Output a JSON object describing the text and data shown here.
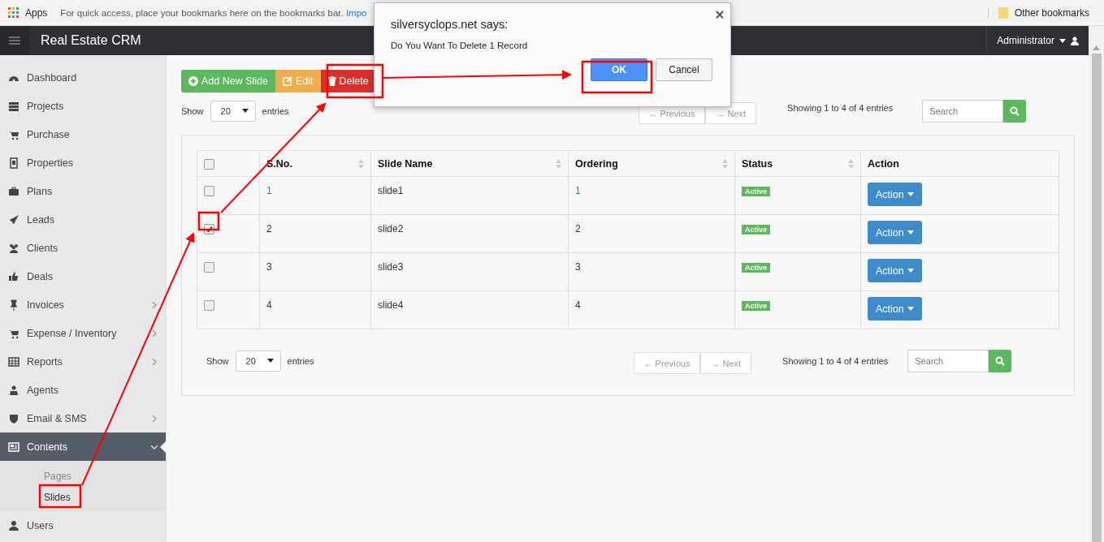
{
  "bookmarks_bar": {
    "apps": "Apps",
    "hint": "For quick access, place your bookmarks here on the bookmarks bar.",
    "import_link": "Impo",
    "other": "Other bookmarks"
  },
  "header": {
    "title": "Real Estate CRM",
    "user": "Administrator"
  },
  "sidebar": {
    "items": [
      {
        "label": "Dashboard",
        "expandable": false,
        "expanded": false,
        "selected": false
      },
      {
        "label": "Projects",
        "expandable": false,
        "expanded": false,
        "selected": false
      },
      {
        "label": "Purchase",
        "expandable": false,
        "expanded": false,
        "selected": false
      },
      {
        "label": "Properties",
        "expandable": false,
        "expanded": false,
        "selected": false
      },
      {
        "label": "Plans",
        "expandable": false,
        "expanded": false,
        "selected": false
      },
      {
        "label": "Leads",
        "expandable": false,
        "expanded": false,
        "selected": false
      },
      {
        "label": "Clients",
        "expandable": false,
        "expanded": false,
        "selected": false
      },
      {
        "label": "Deals",
        "expandable": false,
        "expanded": false,
        "selected": false
      },
      {
        "label": "Invoices",
        "expandable": true,
        "expanded": false,
        "selected": false
      },
      {
        "label": "Expense / Inventory",
        "expandable": true,
        "expanded": false,
        "selected": false
      },
      {
        "label": "Reports",
        "expandable": true,
        "expanded": false,
        "selected": false
      },
      {
        "label": "Agents",
        "expandable": false,
        "expanded": false,
        "selected": false
      },
      {
        "label": "Email & SMS",
        "expandable": true,
        "expanded": false,
        "selected": false
      },
      {
        "label": "Contents",
        "expandable": true,
        "expanded": true,
        "selected": true,
        "children": [
          {
            "label": "Pages",
            "selected": false
          },
          {
            "label": "Slides",
            "selected": true
          }
        ]
      },
      {
        "label": "Users",
        "expandable": false,
        "expanded": false,
        "selected": false
      }
    ]
  },
  "toolbar": {
    "buttons": [
      {
        "label": "Add New Slide",
        "kind": "add"
      },
      {
        "label": "Edit",
        "kind": "edit"
      },
      {
        "label": "Delete",
        "kind": "delete"
      }
    ]
  },
  "top_controls": {
    "show": "Show",
    "page_size": "20",
    "entries": "entries",
    "previous": "← Previous",
    "next": "→ Next",
    "info": "Showing 1 to 4 of 4 entries",
    "search_placeholder": "Search"
  },
  "table": {
    "header_checked": false,
    "columns": [
      {
        "label": "S.No.",
        "sortable": true
      },
      {
        "label": "Slide Name",
        "sortable": true
      },
      {
        "label": "Ordering",
        "sortable": true
      },
      {
        "label": "Status",
        "sortable": true
      },
      {
        "label": "Action",
        "sortable": false
      }
    ],
    "rows": [
      {
        "checked": false,
        "linked": true,
        "sno": "1",
        "name": "slide1",
        "ordering": "1",
        "status": "Active",
        "action": "Action"
      },
      {
        "checked": true,
        "linked": false,
        "sno": "2",
        "name": "slide2",
        "ordering": "2",
        "status": "Active",
        "action": "Action"
      },
      {
        "checked": false,
        "linked": false,
        "sno": "3",
        "name": "slide3",
        "ordering": "3",
        "status": "Active",
        "action": "Action"
      },
      {
        "checked": false,
        "linked": false,
        "sno": "4",
        "name": "slide4",
        "ordering": "4",
        "status": "Active",
        "action": "Action"
      }
    ]
  },
  "bottom_controls": {
    "show": "Show",
    "page_size": "20",
    "entries": "entries",
    "previous": "← Previous",
    "next": "→ Next",
    "info": "Showing 1 to 4 of 4 entries",
    "search_placeholder": "Search"
  },
  "dialog": {
    "title": "silversyclops.net says:",
    "message": "Do You Want To Delete 1 Record",
    "ok": "OK",
    "cancel": "Cancel"
  }
}
